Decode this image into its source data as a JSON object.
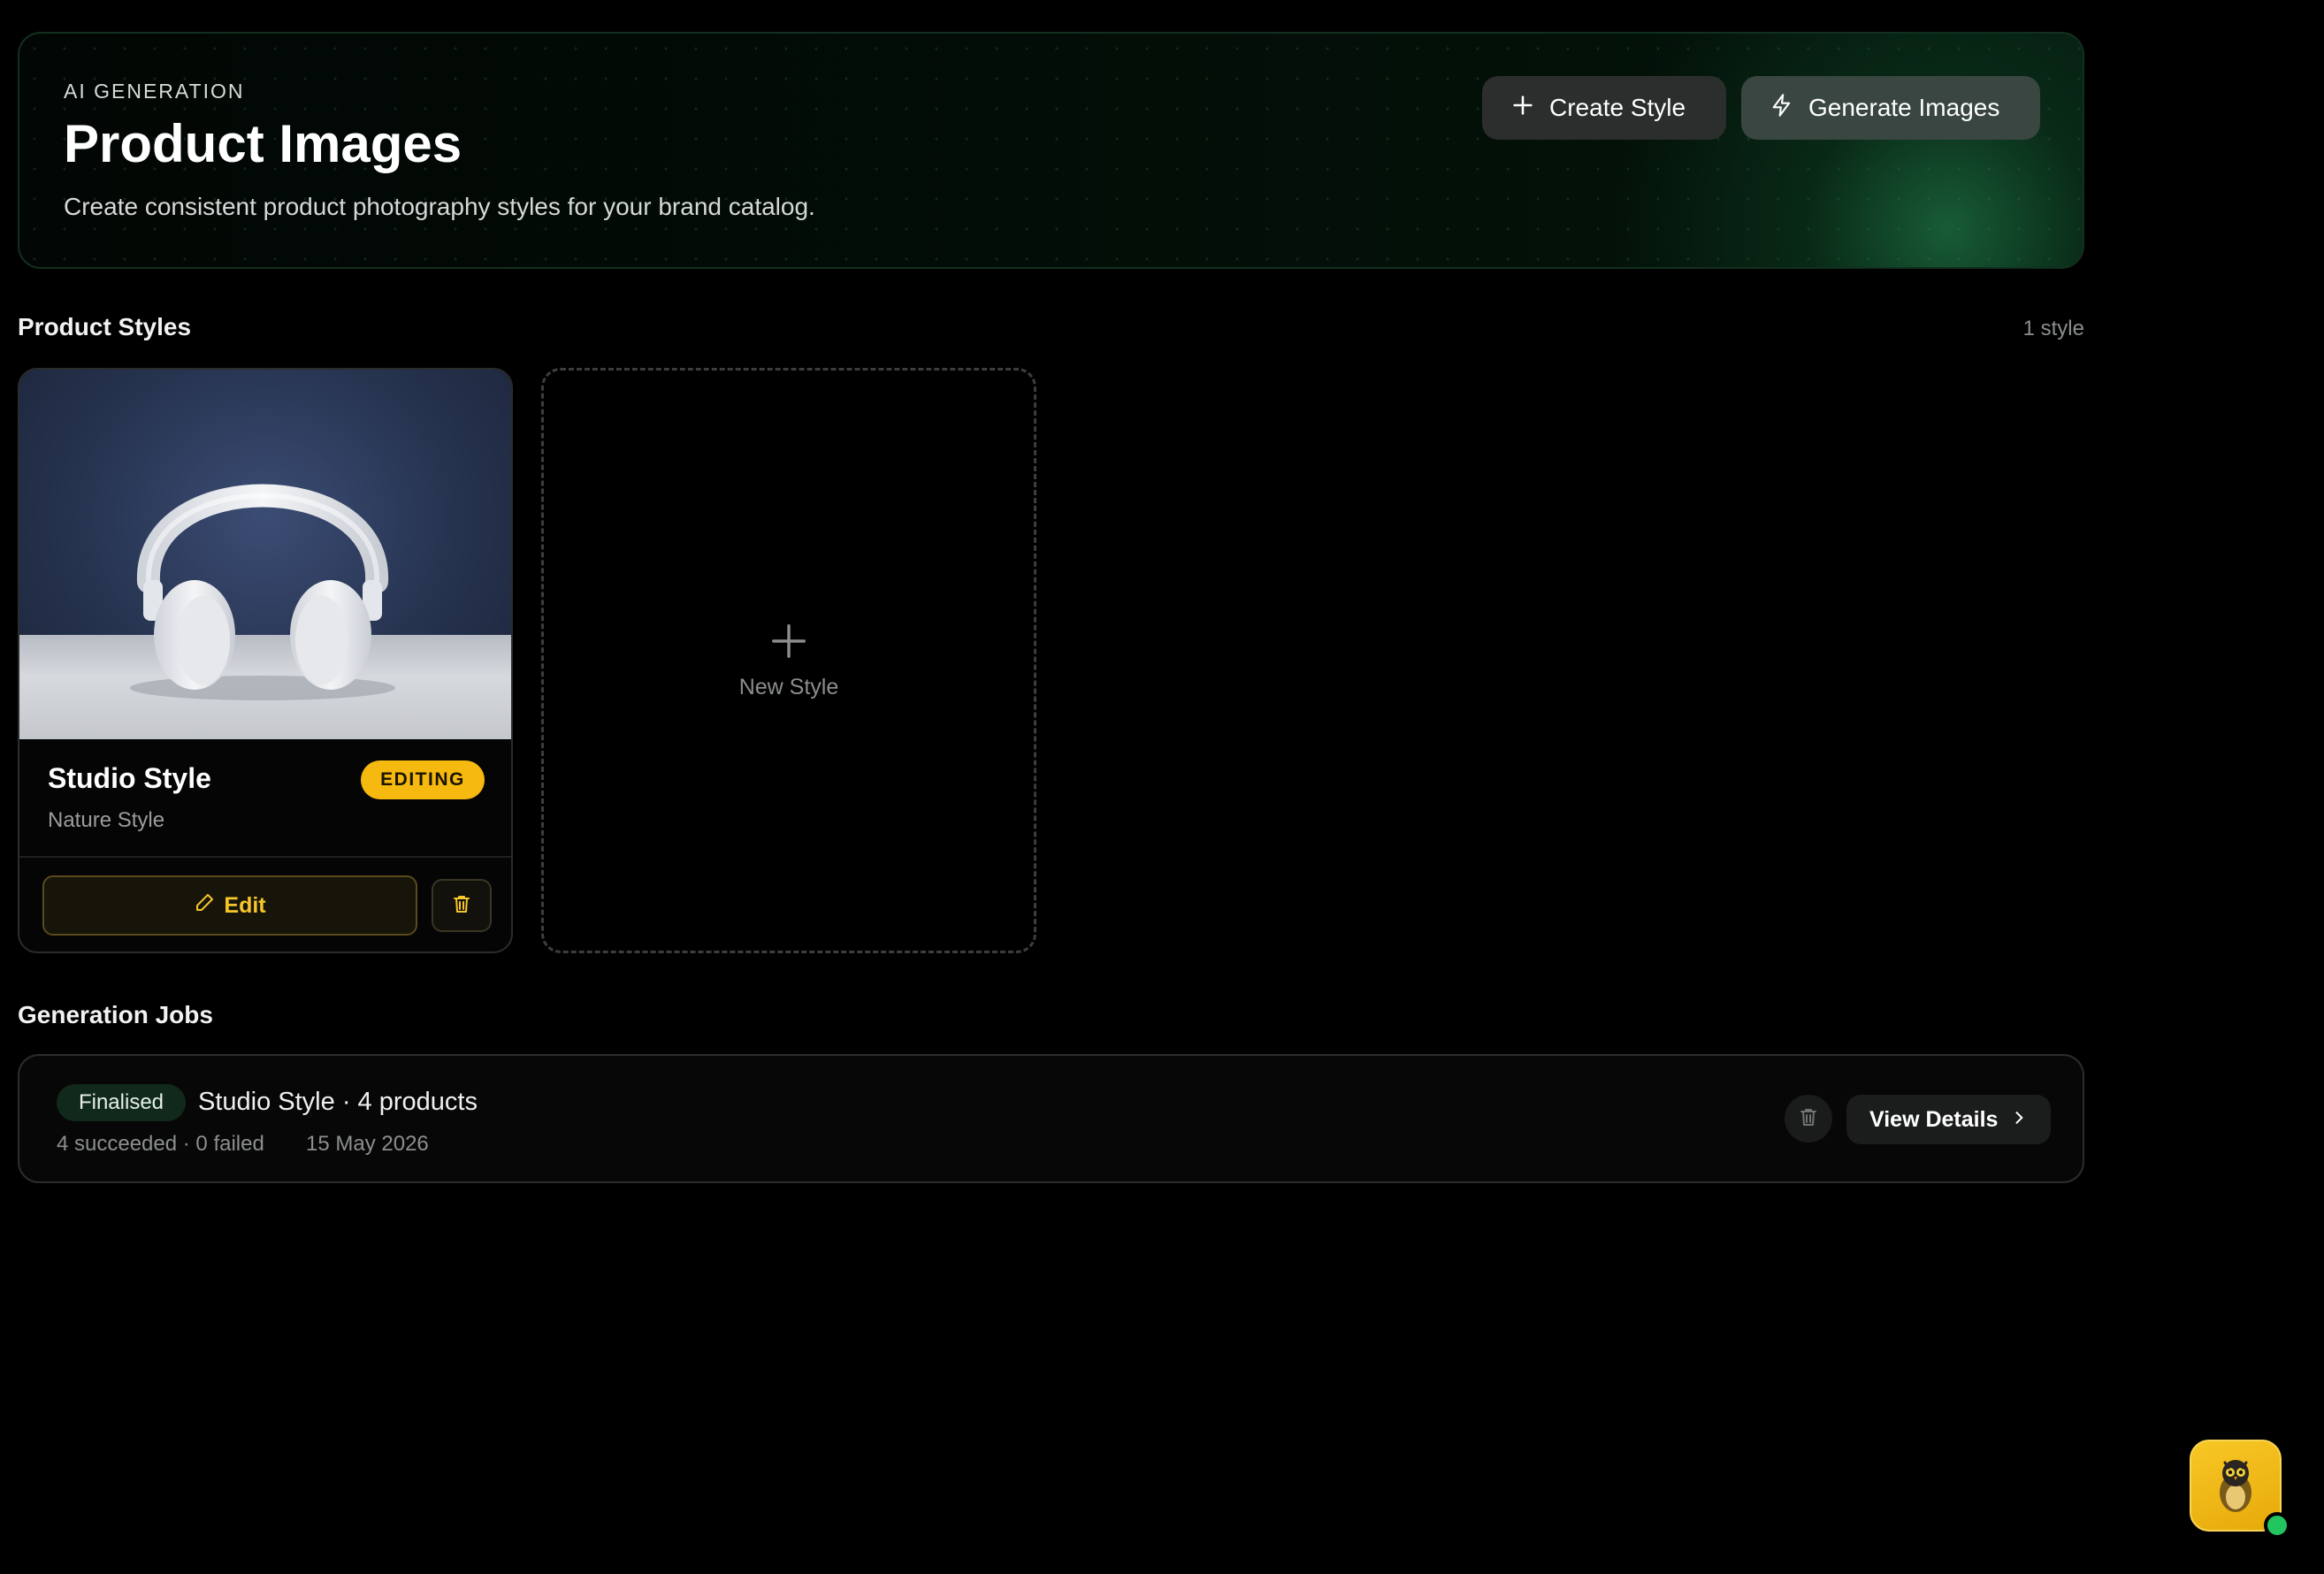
{
  "hero": {
    "eyebrow": "AI GENERATION",
    "title": "Product Images",
    "subtitle": "Create consistent product photography styles for your brand catalog.",
    "create_style_label": "Create Style",
    "generate_images_label": "Generate Images"
  },
  "styles": {
    "heading": "Product Styles",
    "count": "1 style",
    "items": [
      {
        "title": "Studio Style",
        "subtitle": "Nature Style",
        "badge": "EDITING",
        "edit_label": "Edit",
        "image": "white-headphones-on-table"
      }
    ],
    "new_style_label": "New Style"
  },
  "jobs": {
    "heading": "Generation Jobs",
    "items": [
      {
        "status": "Finalised",
        "title": "Studio Style · 4 products",
        "stats": "4 succeeded · 0 failed",
        "date": "15 May 2026",
        "view_label": "View Details"
      }
    ]
  },
  "colors": {
    "accent_yellow": "#f5b90f",
    "accent_green": "#22c55e",
    "background": "#000000"
  }
}
